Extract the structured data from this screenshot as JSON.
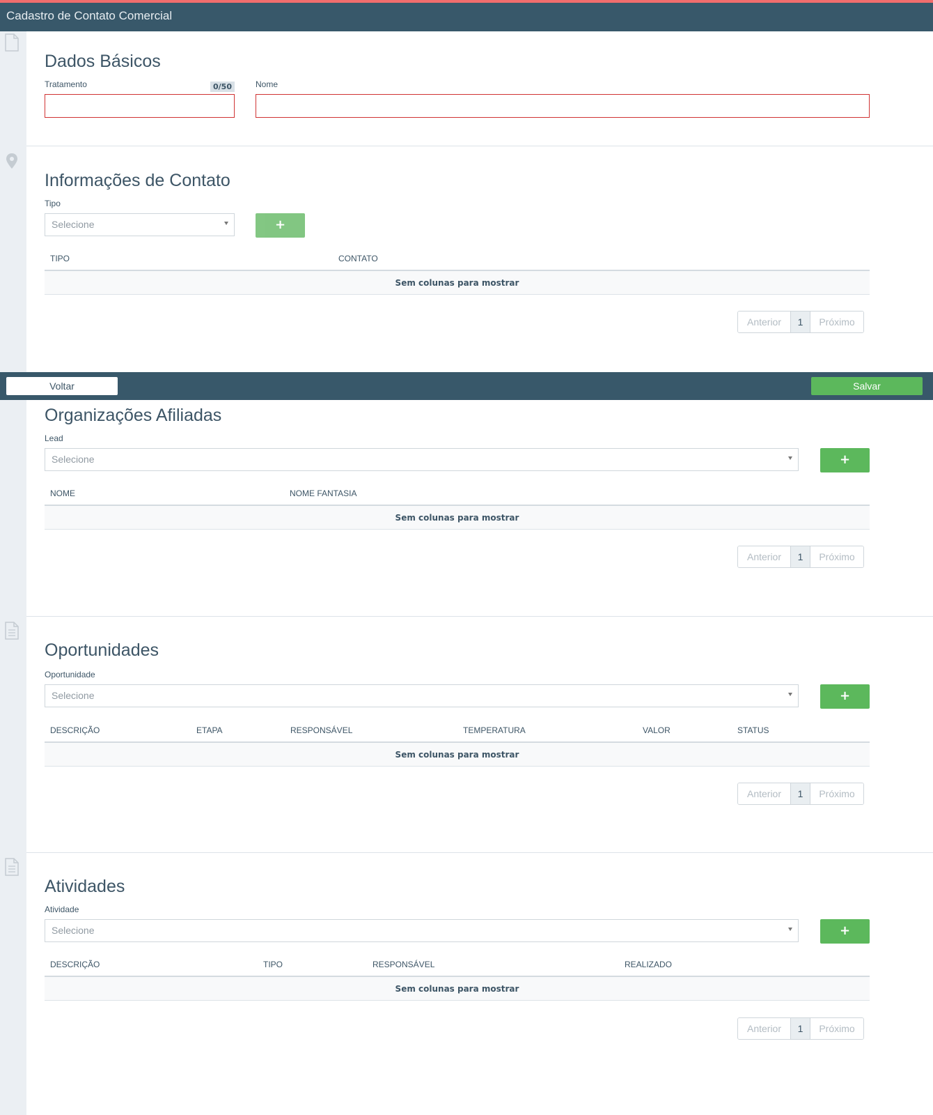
{
  "header": {
    "title": "Cadastro de Contato Comercial"
  },
  "basic": {
    "title": "Dados Básicos",
    "treatment_label": "Tratamento",
    "treatment_counter": "0/50",
    "treatment_value": "",
    "name_label": "Nome",
    "name_value": ""
  },
  "contact_info": {
    "title": "Informações de Contato",
    "type_label": "Tipo",
    "type_placeholder": "Selecione",
    "add_label": "+",
    "columns": [
      "TIPO",
      "CONTATO"
    ],
    "empty_text": "Sem colunas para mostrar",
    "pager": {
      "prev": "Anterior",
      "page": "1",
      "next": "Próximo"
    }
  },
  "footer": {
    "back_label": "Voltar",
    "save_label": "Salvar"
  },
  "affiliates": {
    "title": "Organizações Afiliadas",
    "lead_label": "Lead",
    "lead_placeholder": "Selecione",
    "add_label": "+",
    "columns": [
      "NOME",
      "NOME FANTASIA"
    ],
    "empty_text": "Sem colunas para mostrar",
    "pager": {
      "prev": "Anterior",
      "page": "1",
      "next": "Próximo"
    }
  },
  "opportunities": {
    "title": "Oportunidades",
    "opportunity_label": "Oportunidade",
    "opportunity_placeholder": "Selecione",
    "add_label": "+",
    "columns": [
      "DESCRIÇÃO",
      "ETAPA",
      "RESPONSÁVEL",
      "TEMPERATURA",
      "VALOR",
      "STATUS"
    ],
    "empty_text": "Sem colunas para mostrar",
    "pager": {
      "prev": "Anterior",
      "page": "1",
      "next": "Próximo"
    }
  },
  "activities": {
    "title": "Atividades",
    "activity_label": "Atividade",
    "activity_placeholder": "Selecione",
    "add_label": "+",
    "columns": [
      "DESCRIÇÃO",
      "TIPO",
      "RESPONSÁVEL",
      "REALIZADO"
    ],
    "empty_text": "Sem colunas para mostrar",
    "pager": {
      "prev": "Anterior",
      "page": "1",
      "next": "Próximo"
    }
  },
  "icons": {
    "basic": "document-icon",
    "contact": "location-pin-icon",
    "affiliates": "document-lines-icon",
    "opportunities": "document-lines-icon",
    "activities": "document-lines-icon"
  },
  "colors": {
    "header_bg": "#38586a",
    "accent_top": "#f26d6d",
    "primary_green": "#5cb85c",
    "error_red": "#d03333",
    "gutter_bg": "#ebeff3"
  }
}
